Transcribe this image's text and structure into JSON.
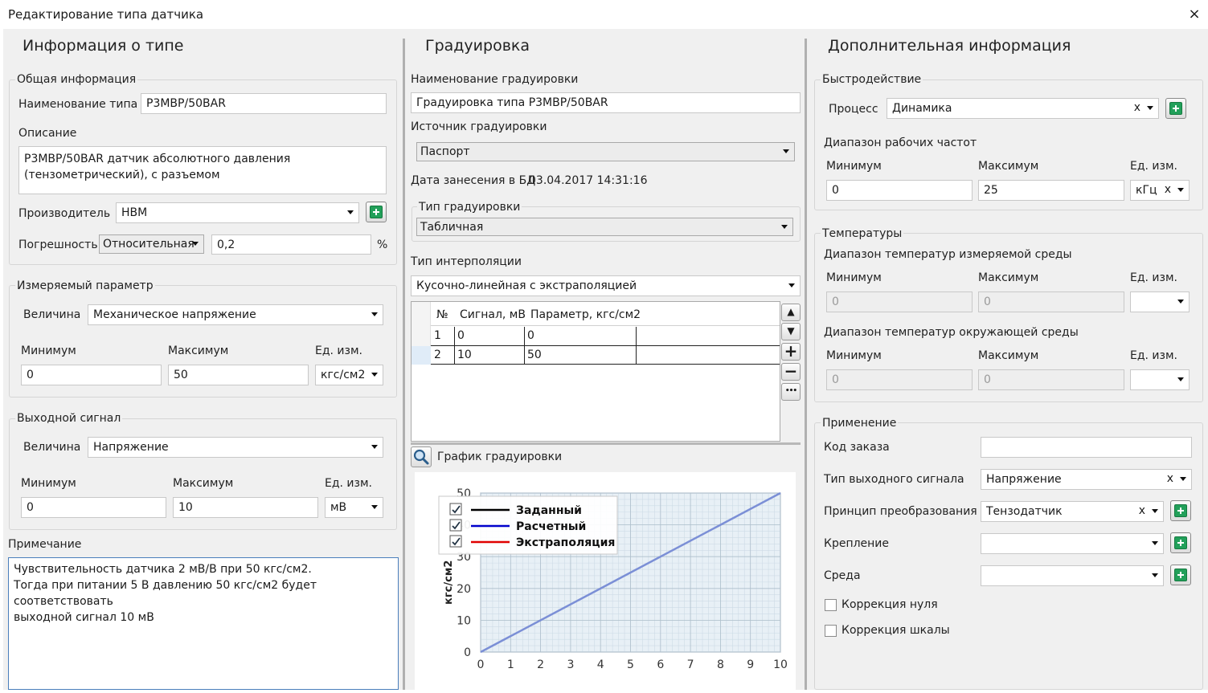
{
  "window": {
    "title": "Редактирование типа датчика",
    "close_glyph": "×"
  },
  "left": {
    "heading": "Информация о типе",
    "general": {
      "group_label": "Общая информация",
      "name_label": "Наименование типа",
      "name_value": "P3MBP/50BAR",
      "desc_label": "Описание",
      "desc_value": "P3MBP/50BAR датчик абсолютного давления (тензометрический), с разъемом",
      "manufacturer_label": "Производитель",
      "manufacturer_value": "HBM",
      "error_label": "Погрешность",
      "error_type": "Относительная",
      "error_value": "0,2",
      "error_unit": "%"
    },
    "measured": {
      "group_label": "Измеряемый параметр",
      "quantity_label": "Величина",
      "quantity_value": "Механическое напряжение",
      "min_label": "Минимум",
      "max_label": "Максимум",
      "unit_label": "Ед. изм.",
      "min_value": "0",
      "max_value": "50",
      "unit_value": "кгс/см2"
    },
    "output": {
      "group_label": "Выходной сигнал",
      "quantity_label": "Величина",
      "quantity_value": "Напряжение",
      "min_label": "Минимум",
      "max_label": "Максимум",
      "unit_label": "Ед. изм.",
      "min_value": "0",
      "max_value": "10",
      "unit_value": "мВ"
    },
    "note": {
      "label": "Примечание",
      "line1": "Чувствительность датчика 2 мВ/В при 50 кгс/см2.",
      "line2": "Тогда при питании 5 В давлению 50 кгс/см2 будет соответствовать",
      "line3": "выходной сигнал 10 мВ"
    }
  },
  "middle": {
    "heading": "Градуировка",
    "name_label": "Наименование градуировки",
    "name_value": "Градуировка типа P3MBP/50BAR",
    "source_label": "Источник градуировки",
    "source_value": "Паспорт",
    "date_label": "Дата занесения в БД",
    "date_value": "03.04.2017 14:31:16",
    "type_group_label": "Тип градуировки",
    "type_value": "Табличная",
    "interp_label": "Тип интерполяции",
    "interp_value": "Кусочно-линейная с экстраполяцией",
    "table": {
      "headers": [
        "№",
        "Сигнал, мВ",
        "Параметр, кгс/см2"
      ],
      "rows": [
        [
          "1",
          "0",
          "0"
        ],
        [
          "2",
          "10",
          "50"
        ]
      ]
    },
    "buttons": {
      "up": "▲",
      "down": "▼",
      "add": "+",
      "remove": "−",
      "more": "•••"
    },
    "chart_label": "График градуировки"
  },
  "right": {
    "heading": "Дополнительная информация",
    "perf": {
      "group_label": "Быстродействие",
      "process_label": "Процесс",
      "process_value": "Динамика",
      "range_label": "Диапазон рабочих частот",
      "min_label": "Минимум",
      "max_label": "Максимум",
      "unit_label": "Ед. изм.",
      "min_value": "0",
      "max_value": "25",
      "unit_value": "кГц"
    },
    "temps": {
      "group_label": "Температуры",
      "measured_label": "Диапазон температур измеряемой среды",
      "ambient_label": "Диапазон температур окружающей среды",
      "min_label": "Минимум",
      "max_label": "Максимум",
      "unit_label": "Ед. изм.",
      "min_placeholder": "0",
      "max_placeholder": "0"
    },
    "usage": {
      "group_label": "Применение",
      "order_label": "Код заказа",
      "order_value": "",
      "signal_type_label": "Тип выходного сигнала",
      "signal_type_value": "Напряжение",
      "principle_label": "Принцип преобразования",
      "principle_value": "Тензодатчик",
      "mount_label": "Крепление",
      "medium_label": "Среда",
      "zero_corr_label": "Коррекция нуля",
      "scale_corr_label": "Коррекция шкалы"
    },
    "clear_glyph": "x"
  },
  "chart_data": {
    "type": "line",
    "title": "",
    "xlabel": "",
    "ylabel": "кгс/см2",
    "xlim": [
      0,
      10
    ],
    "ylim": [
      0,
      50
    ],
    "x_ticks": [
      "0",
      "1",
      "2",
      "3",
      "4",
      "5",
      "6",
      "7",
      "8",
      "9",
      "10"
    ],
    "y_ticks": [
      "0",
      "10",
      "20",
      "30",
      "40",
      "50"
    ],
    "grid": true,
    "legend_position": "top-left",
    "legend": [
      {
        "name": "Заданный",
        "color": "#000000",
        "checked": true
      },
      {
        "name": "Расчетный",
        "color": "#0000cc",
        "checked": true
      },
      {
        "name": "Экстраполяция",
        "color": "#e00000",
        "checked": true
      }
    ],
    "series": [
      {
        "name": "Расчетный",
        "color": "#7b8fd6",
        "x": [
          0,
          10
        ],
        "y": [
          0,
          50
        ]
      }
    ]
  }
}
